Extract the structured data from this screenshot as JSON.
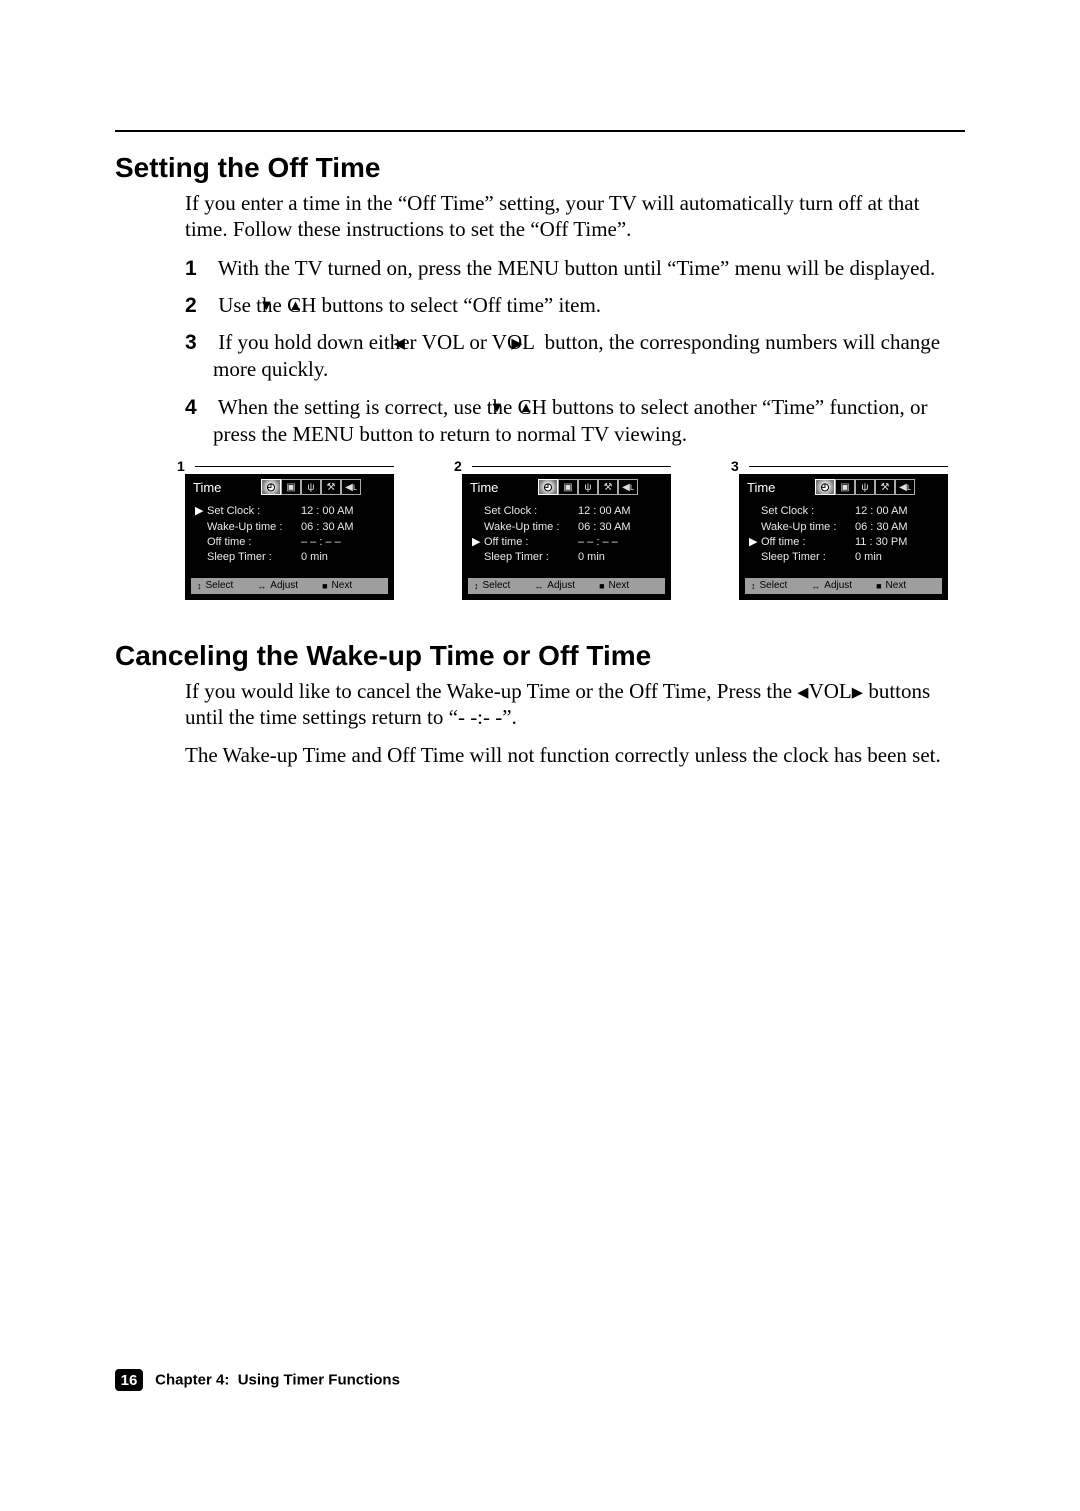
{
  "sections": {
    "offtime": {
      "heading": "Setting the Off Time",
      "intro": "If you enter a time in the “Off Time” setting, your TV will automatically turn off at that time. Follow these instructions to set the “Off Time”.",
      "steps": {
        "s1_a": "With the TV turned on, press the MENU button until “Time” menu will be displayed.",
        "s2_a": "Use the ",
        "s2_b": "CH",
        "s2_c": " buttons to select “Off time” item.",
        "s3_a": "If you hold down either ",
        "s3_b": "VOL or VOL ",
        "s3_c": " button, the corresponding numbers will change more quickly.",
        "s4_a": "When the setting is correct, use the ",
        "s4_b": "CH",
        "s4_c": " buttons to select another “Time” function, or press the MENU button to return to normal TV viewing."
      }
    },
    "cancel": {
      "heading": "Canceling the Wake-up Time or Off Time",
      "p1_a": "If you would like to cancel the Wake-up Time or the Off Time, Press the ",
      "p1_b": "VOL",
      "p1_c": " buttons until the time settings return to “- -:- -”.",
      "p2": "The Wake-up Time and Off Time will not function correctly unless the clock has been set."
    }
  },
  "glyphs": {
    "tri_down": "▼",
    "tri_up": "▲",
    "tri_left": "◀",
    "tri_right": "▶",
    "stop": "■",
    "updown": "↕",
    "leftright": "↔"
  },
  "osd": {
    "title": "Time",
    "labels": {
      "set_clock": "Set Clock :",
      "wake_up": "Wake-Up time :",
      "off_time": "Off time  :",
      "sleep": "Sleep Timer :"
    },
    "footer": {
      "select": "Select",
      "adjust": "Adjust",
      "next": "Next"
    },
    "icons": [
      {
        "name": "clock-icon",
        "glyph": "◴",
        "active": true
      },
      {
        "name": "picture-icon",
        "glyph": "▣",
        "active": false
      },
      {
        "name": "input-icon",
        "glyph": "ψ",
        "active": false
      },
      {
        "name": "antenna-icon",
        "glyph": "⚒",
        "active": false
      },
      {
        "name": "speaker-icon",
        "glyph": "◀ʟ",
        "active": false
      }
    ],
    "screens": [
      {
        "num": "1",
        "cursor_row": 0,
        "values": {
          "set_clock": "12 : 00 AM",
          "wake_up": "06 : 30 AM",
          "off_time": "– – : – –",
          "sleep": "0 min"
        }
      },
      {
        "num": "2",
        "cursor_row": 2,
        "values": {
          "set_clock": "12 : 00 AM",
          "wake_up": "06 : 30 AM",
          "off_time": "– – : – –",
          "sleep": "0 min"
        }
      },
      {
        "num": "3",
        "cursor_row": 2,
        "values": {
          "set_clock": "12 : 00 AM",
          "wake_up": "06 : 30 AM",
          "off_time": "11 : 30 PM",
          "sleep": "0 min"
        }
      }
    ]
  },
  "footer": {
    "page_number": "16",
    "chapter": "Chapter 4:",
    "chapter_title": "Using Timer Functions"
  }
}
